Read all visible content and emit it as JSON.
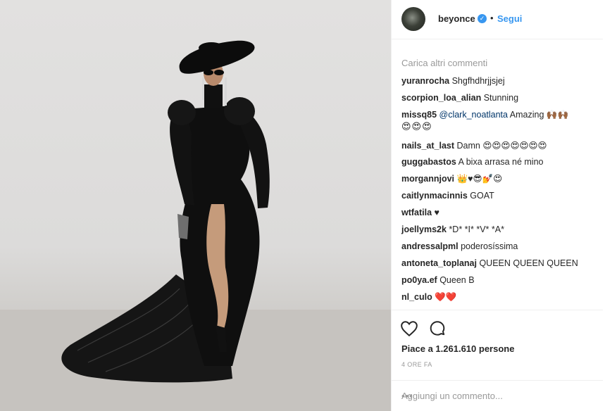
{
  "post": {
    "username": "beyonce",
    "verified_icon": "verified-badge-icon",
    "separator": "•",
    "follow_label": "Segui"
  },
  "comments_section": {
    "load_more": "Carica altri commenti",
    "items": [
      {
        "user": "yuranrocha",
        "text": "Shgfhdhrjjsjej"
      },
      {
        "user": "scorpion_loa_alian",
        "text": "Stunning"
      },
      {
        "user": "missq85",
        "mention": "@clark_noatlanta",
        "text": "Amazing 🙌🏾🙌🏾",
        "text2": "😍😍😍"
      },
      {
        "user": "nails_at_last",
        "text": "Damn 😍😍😍😍😍😍😍"
      },
      {
        "user": "guggabastos",
        "text": "A bixa arrasa né mino"
      },
      {
        "user": "morgannjovi",
        "text": "👑♥😎💅😍"
      },
      {
        "user": "caitlynmacinnis",
        "text": "GOAT"
      },
      {
        "user": "wtfatila",
        "text": "♥"
      },
      {
        "user": "joellyms2k",
        "text": "*D* *I* *V* *A*"
      },
      {
        "user": "andressalpml",
        "text": "poderosíssima"
      },
      {
        "user": "antoneta_toplanaj",
        "text": "QUEEN QUEEN QUEEN"
      },
      {
        "user": "po0ya.ef",
        "text": "Queen B"
      },
      {
        "user": "nl_culo",
        "text": "❤️❤️"
      }
    ]
  },
  "actions": {
    "like_icon": "heart-icon",
    "comment_icon": "comment-bubble-icon"
  },
  "likes": {
    "label": "Piace a 1.261.610 persone"
  },
  "timestamp": "4 ORE FA",
  "add_comment": {
    "placeholder": "Aggiungi un commento...",
    "more_icon": "more-options-icon",
    "more_glyph": "•••"
  },
  "colors": {
    "link_blue": "#3897f0",
    "text": "#262626",
    "muted": "#999999",
    "like_red": "#ed4956"
  }
}
